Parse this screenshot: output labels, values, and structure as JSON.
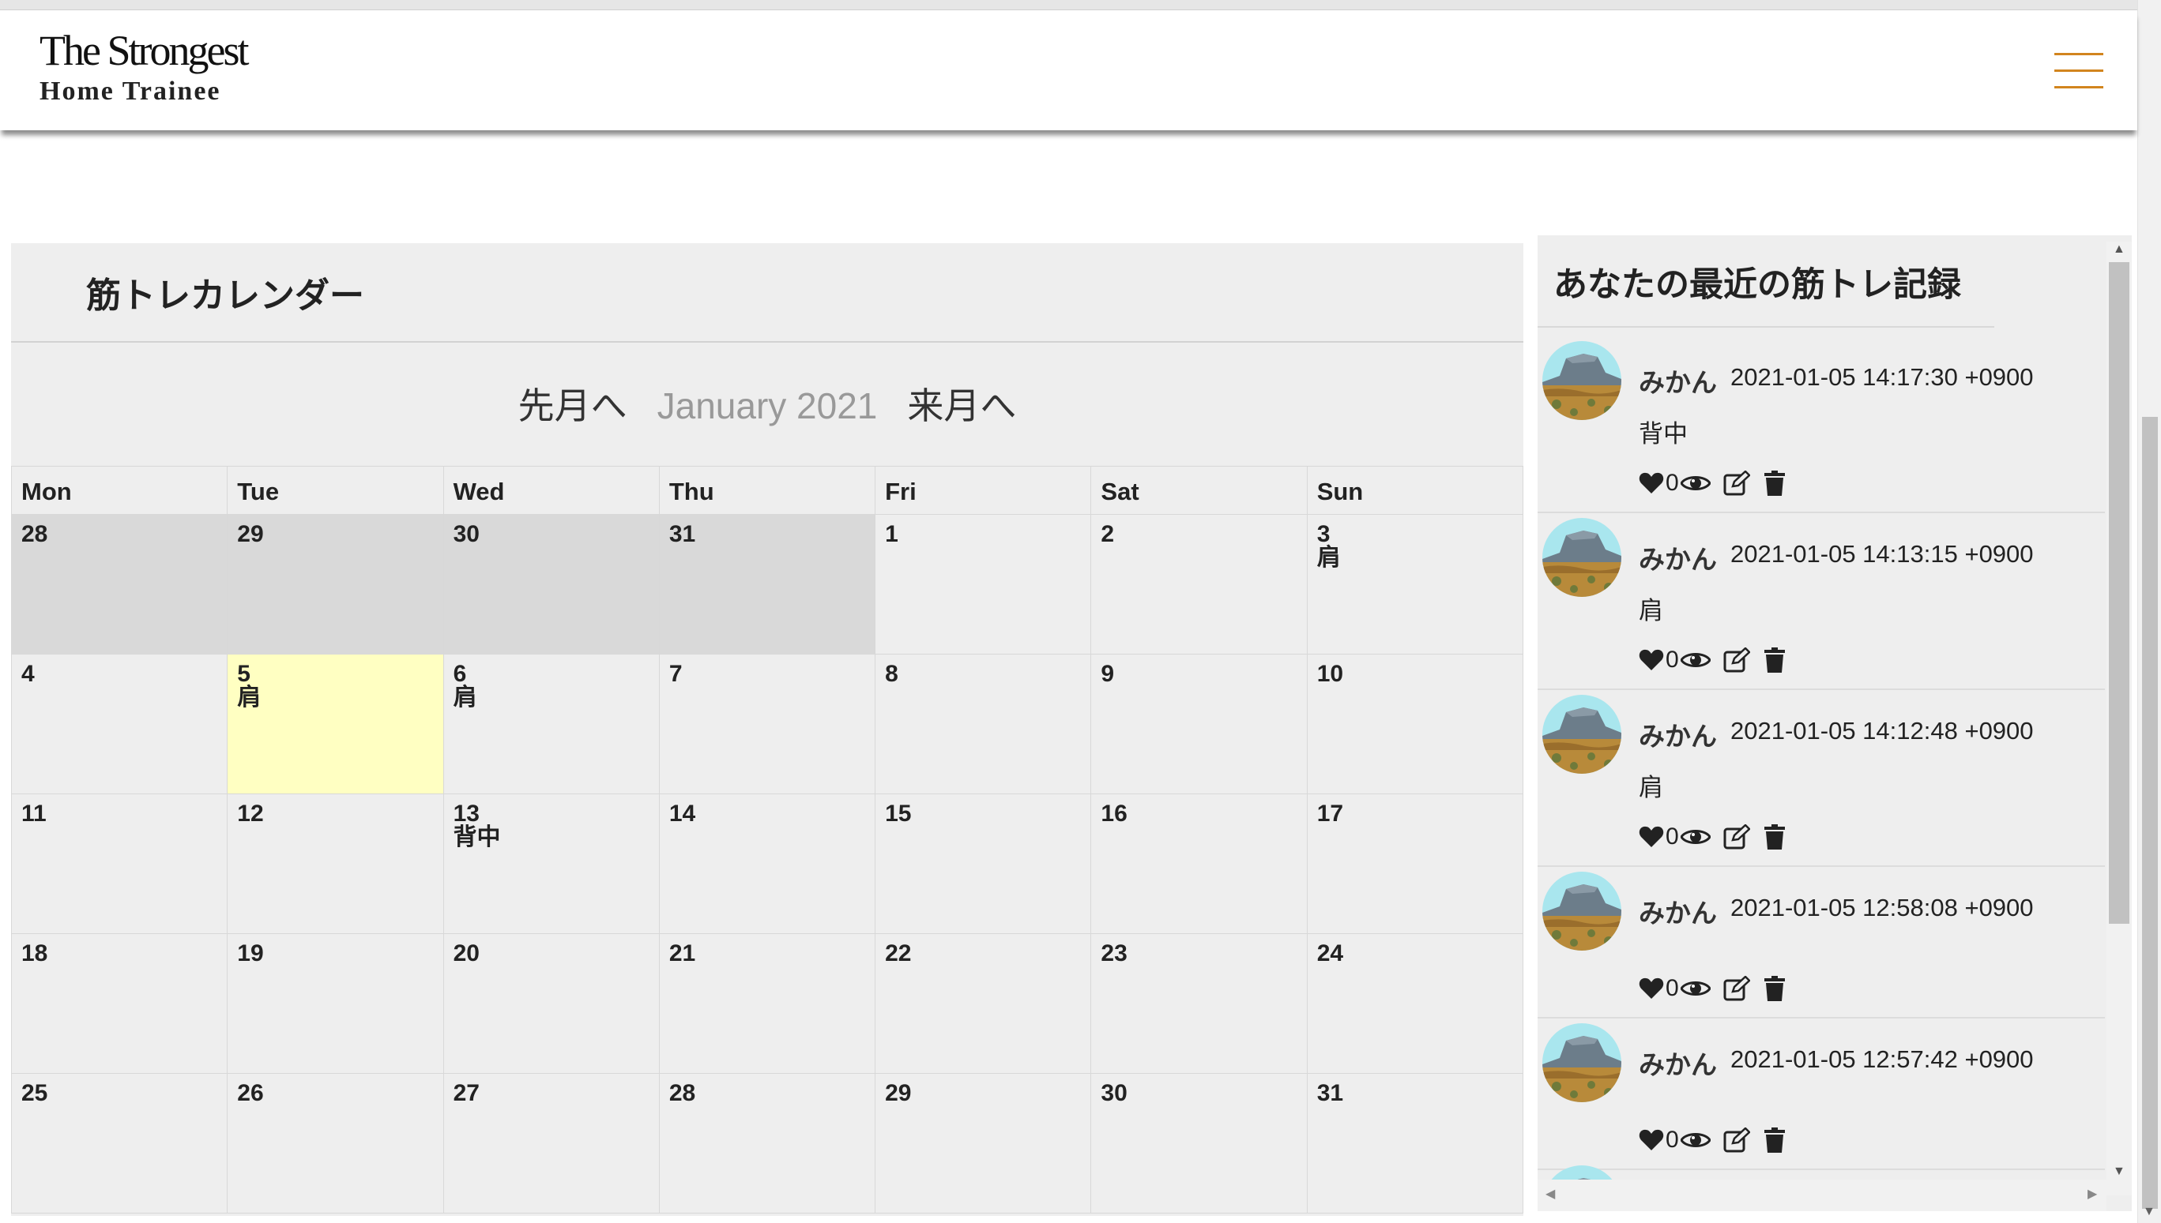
{
  "header": {
    "logo_line1": "The Strongest",
    "logo_line2": "Home Trainee"
  },
  "calendar": {
    "title": "筋トレカレンダー",
    "prev_label": "先月へ",
    "month_label": "January 2021",
    "next_label": "来月へ",
    "weekdays": [
      "Mon",
      "Tue",
      "Wed",
      "Thu",
      "Fri",
      "Sat",
      "Sun"
    ],
    "weeks": [
      [
        {
          "day": "28",
          "event": ""
        },
        {
          "day": "29",
          "event": ""
        },
        {
          "day": "30",
          "event": ""
        },
        {
          "day": "31",
          "event": ""
        },
        {
          "day": "1",
          "event": ""
        },
        {
          "day": "2",
          "event": ""
        },
        {
          "day": "3",
          "event": "肩"
        }
      ],
      [
        {
          "day": "4",
          "event": ""
        },
        {
          "day": "5",
          "event": "肩"
        },
        {
          "day": "6",
          "event": "肩"
        },
        {
          "day": "7",
          "event": ""
        },
        {
          "day": "8",
          "event": ""
        },
        {
          "day": "9",
          "event": ""
        },
        {
          "day": "10",
          "event": ""
        }
      ],
      [
        {
          "day": "11",
          "event": ""
        },
        {
          "day": "12",
          "event": ""
        },
        {
          "day": "13",
          "event": "背中"
        },
        {
          "day": "14",
          "event": ""
        },
        {
          "day": "15",
          "event": ""
        },
        {
          "day": "16",
          "event": ""
        },
        {
          "day": "17",
          "event": ""
        }
      ],
      [
        {
          "day": "18",
          "event": ""
        },
        {
          "day": "19",
          "event": ""
        },
        {
          "day": "20",
          "event": ""
        },
        {
          "day": "21",
          "event": ""
        },
        {
          "day": "22",
          "event": ""
        },
        {
          "day": "23",
          "event": ""
        },
        {
          "day": "24",
          "event": ""
        }
      ],
      [
        {
          "day": "25",
          "event": ""
        },
        {
          "day": "26",
          "event": ""
        },
        {
          "day": "27",
          "event": ""
        },
        {
          "day": "28",
          "event": ""
        },
        {
          "day": "29",
          "event": ""
        },
        {
          "day": "30",
          "event": ""
        },
        {
          "day": "31",
          "event": ""
        }
      ]
    ]
  },
  "records": {
    "title": "あなたの最近の筋トレ記録",
    "posts": [
      {
        "user": "みかん",
        "time": "2021-01-05 14:17:30 +0900",
        "body": "背中",
        "likes": "0"
      },
      {
        "user": "みかん",
        "time": "2021-01-05 14:13:15 +0900",
        "body": "肩",
        "likes": "0"
      },
      {
        "user": "みかん",
        "time": "2021-01-05 14:12:48 +0900",
        "body": "肩",
        "likes": "0"
      },
      {
        "user": "みかん",
        "time": "2021-01-05 12:58:08 +0900",
        "body": "",
        "likes": "0"
      },
      {
        "user": "みかん",
        "time": "2021-01-05 12:57:42 +0900",
        "body": "",
        "likes": "0"
      }
    ]
  },
  "colors": {
    "hamburger": "#d2851e",
    "today_highlight": "#ffffc2",
    "other_month": "#d9d9d9",
    "panel_bg": "#eeeeee"
  },
  "icons": [
    "hamburger-menu-icon",
    "heart-icon",
    "eye-icon",
    "edit-icon",
    "trash-icon",
    "user-avatar"
  ]
}
